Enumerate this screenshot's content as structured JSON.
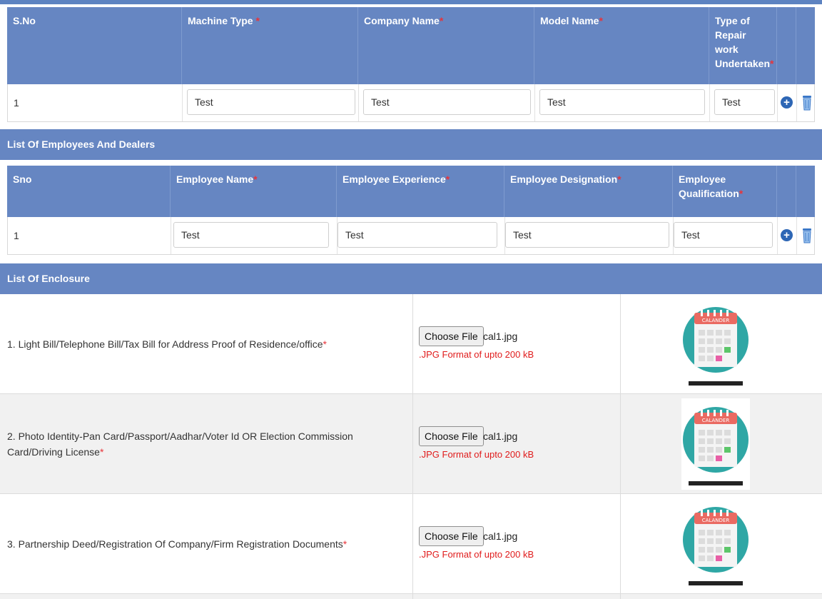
{
  "machines": {
    "headers": {
      "sno": "S.No",
      "machine_type": "Machine Type",
      "company_name": "Company Name",
      "model_name": "Model Name",
      "repair_line1": "Type of",
      "repair_line2": "Repair work",
      "repair_line3": "Undertaken"
    },
    "row": {
      "sno": "1",
      "machine_type": "Test",
      "company_name": "Test",
      "model_name": "Test",
      "repair": "Test"
    }
  },
  "employees": {
    "section_title": "List Of Employees And Dealers",
    "headers": {
      "sno": "Sno",
      "name": "Employee Name",
      "experience": "Employee Experience",
      "designation": "Employee Designation",
      "qual_line1": "Employee",
      "qual_line2": "Qualification"
    },
    "row": {
      "sno": "1",
      "name": "Test",
      "experience": "Test",
      "designation": "Test",
      "qualification": "Test"
    }
  },
  "enclosure": {
    "section_title": "List Of Enclosure",
    "choose_label": "Choose File",
    "format_note": ".JPG Format of upto 200 kB",
    "thumb_label": "CALANDER",
    "items": [
      {
        "text": "1. Light Bill/Telephone Bill/Tax Bill for Address Proof of Residence/office",
        "file": "cal1.jpg"
      },
      {
        "text": "2. Photo Identity-Pan Card/Passport/Aadhar/Voter Id OR Election Commission Card/Driving License",
        "file": "cal1.jpg"
      },
      {
        "text": "3. Partnership Deed/Registration Of Company/Firm Registration Documents",
        "file": "cal1.jpg"
      }
    ]
  },
  "required_mark": "*",
  "colors": {
    "header_bg": "#6686c2",
    "required": "#e8343a",
    "format_note": "#e01b1b",
    "add_icon": "#2d66b5"
  },
  "icons": {
    "add": "plus-circle-icon",
    "delete": "trash-icon",
    "thumbnail": "calendar-icon"
  }
}
